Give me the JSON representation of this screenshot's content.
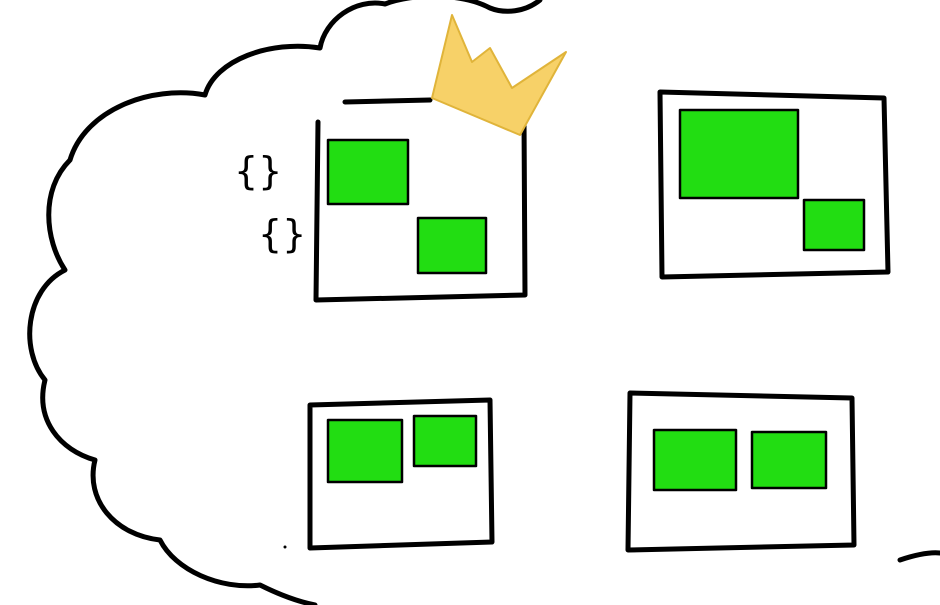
{
  "colors": {
    "background": "#ffffff",
    "stroke": "#000000",
    "block_fill": "#22dd12",
    "crown_fill": "#f7d168",
    "crown_stroke": "#e0b43a"
  },
  "braces": {
    "upper": "{}",
    "lower": "{}"
  },
  "windows": [
    {
      "id": "top-left",
      "crowned": true,
      "block_count": 2
    },
    {
      "id": "top-right",
      "crowned": false,
      "block_count": 2
    },
    {
      "id": "bottom-left",
      "crowned": false,
      "block_count": 2
    },
    {
      "id": "bottom-right",
      "crowned": false,
      "block_count": 2
    }
  ]
}
